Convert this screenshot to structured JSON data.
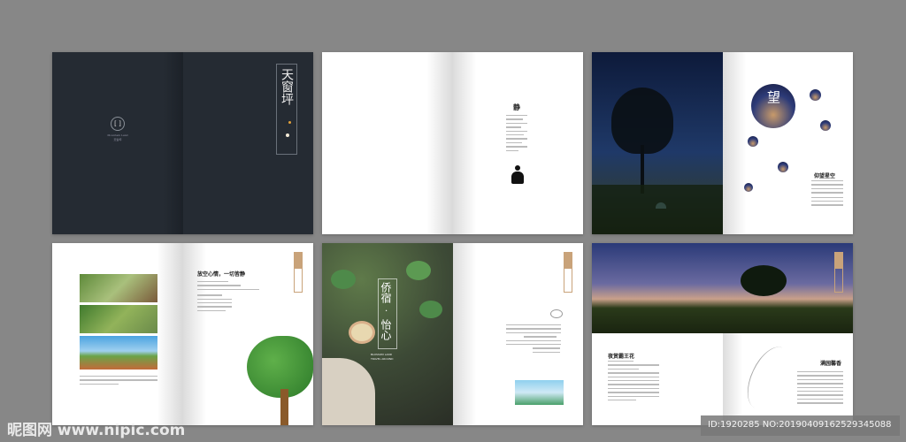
{
  "spread1": {
    "title": "天窗坪",
    "logo_en": "Mountain Land",
    "logo_cn": "天窗坪"
  },
  "spread2": {
    "title": "静"
  },
  "spread3": {
    "circle_title": "望",
    "heading": "仰望星空"
  },
  "spread4": {
    "heading": "放空心情，一切皆静"
  },
  "spread5": {
    "title_line1": "侨宿",
    "title_dot": "·",
    "title_line2": "怡心",
    "subtitle1": "BLOSSOM LAND",
    "subtitle2": "TRAVEL AROUND"
  },
  "spread6": {
    "heading_left": "夜赏霸王花",
    "heading_right": "满园馨香"
  },
  "watermark": {
    "site": "昵图网 www.nipic.com",
    "id": "ID:1920285 NO:20190409162529345088"
  }
}
